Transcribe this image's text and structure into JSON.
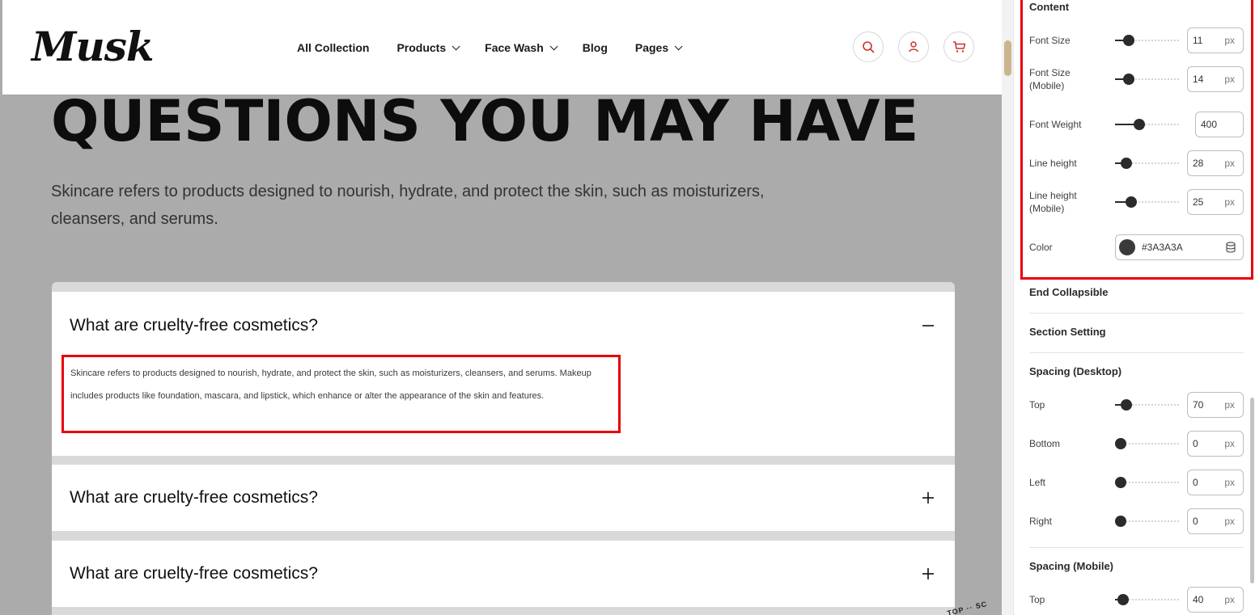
{
  "header": {
    "logo": "Musk",
    "nav": [
      {
        "label": "All Collection",
        "dropdown": false
      },
      {
        "label": "Products",
        "dropdown": true
      },
      {
        "label": "Face Wash",
        "dropdown": true
      },
      {
        "label": "Blog",
        "dropdown": false
      },
      {
        "label": "Pages",
        "dropdown": true
      }
    ],
    "icons": [
      "search-icon",
      "user-icon",
      "cart-icon"
    ]
  },
  "hero": {
    "title": "QUESTIONS YOU MAY HAVE",
    "intro": "Skincare refers to products designed to nourish, hydrate, and protect the skin, such as moisturizers, cleansers, and serums."
  },
  "faq": {
    "items": [
      {
        "question": "What are cruelty-free cosmetics?",
        "expanded": true
      },
      {
        "question": "What are cruelty-free cosmetics?",
        "expanded": false
      },
      {
        "question": "What are cruelty-free cosmetics?",
        "expanded": false
      }
    ],
    "answer": "Skincare refers to products designed to nourish, hydrate, and protect the skin, such as moisturizers, cleansers, and serums. Makeup includes products like foundation, mascara, and lipstick, which enhance or alter the appearance of the skin and features."
  },
  "badge": "TOP ·· SC",
  "panel": {
    "content_title": "Content",
    "content_rows": [
      {
        "label": "Font Size",
        "value": "11",
        "unit": "px",
        "level": 0.15
      },
      {
        "label": "Font Size\n(Mobile)",
        "value": "14",
        "unit": "px",
        "level": 0.15
      },
      {
        "label": "Font Weight",
        "value": "400",
        "unit": "",
        "level": 0.35
      },
      {
        "label": "Line height",
        "value": "28",
        "unit": "px",
        "level": 0.1
      },
      {
        "label": "Line height\n(Mobile)",
        "value": "25",
        "unit": "px",
        "level": 0.2
      }
    ],
    "color": {
      "label": "Color",
      "value": "#3A3A3A"
    },
    "end_collapsible": "End Collapsible",
    "section_setting": "Section Setting",
    "spacing_desktop_title": "Spacing (Desktop)",
    "spacing_desktop": [
      {
        "label": "Top",
        "value": "70",
        "unit": "px",
        "level": 0.1
      },
      {
        "label": "Bottom",
        "value": "0",
        "unit": "px",
        "level": 0
      },
      {
        "label": "Left",
        "value": "0",
        "unit": "px",
        "level": 0
      },
      {
        "label": "Right",
        "value": "0",
        "unit": "px",
        "level": 0
      }
    ],
    "spacing_mobile_title": "Spacing (Mobile)",
    "spacing_mobile": [
      {
        "label": "Top",
        "value": "40",
        "unit": "px",
        "level": 0.05
      }
    ]
  }
}
